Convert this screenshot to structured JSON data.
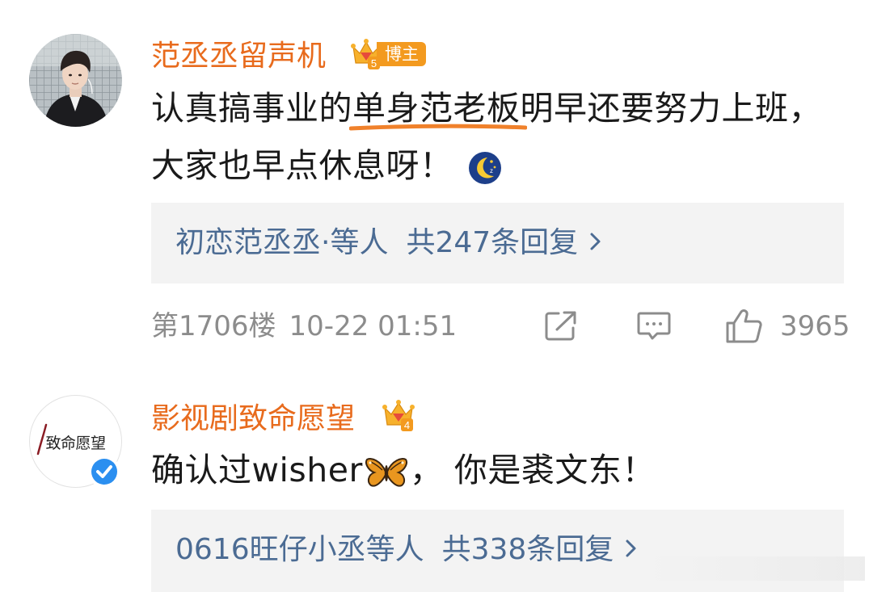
{
  "comments": [
    {
      "username": "范丞丞留声机",
      "badge": {
        "level": "5",
        "tag": "博主",
        "color": "#f39a1f"
      },
      "content": {
        "before": "认真搞事业的",
        "highlight": "单身范老板",
        "after": "明早还要努力上班，大家也早点休息呀！",
        "emoji": "moon-sleep-icon"
      },
      "replies": {
        "names": "初恋范丞丞·等人",
        "count_text": "共247条回复"
      },
      "floor": "第1706楼",
      "time": "10-22 01:51",
      "likes": "3965"
    },
    {
      "username": "影视剧致命愿望",
      "badge": {
        "level": "4",
        "color": "#f39a1f"
      },
      "avatar_text": "致命愿望",
      "verified": true,
      "content": {
        "before": "确认过wisher",
        "emoji": "butterfly-icon",
        "after": "，  你是裘文东！"
      },
      "replies": {
        "names": "0616旺仔小丞等人",
        "count_text": "共338条回复"
      }
    }
  ],
  "colors": {
    "username": "#e86b1d",
    "reply_link": "#4b6b93",
    "meta": "#8c8c8c",
    "highlight_underline": "#f0812b",
    "verified": "#2b8ff0"
  }
}
